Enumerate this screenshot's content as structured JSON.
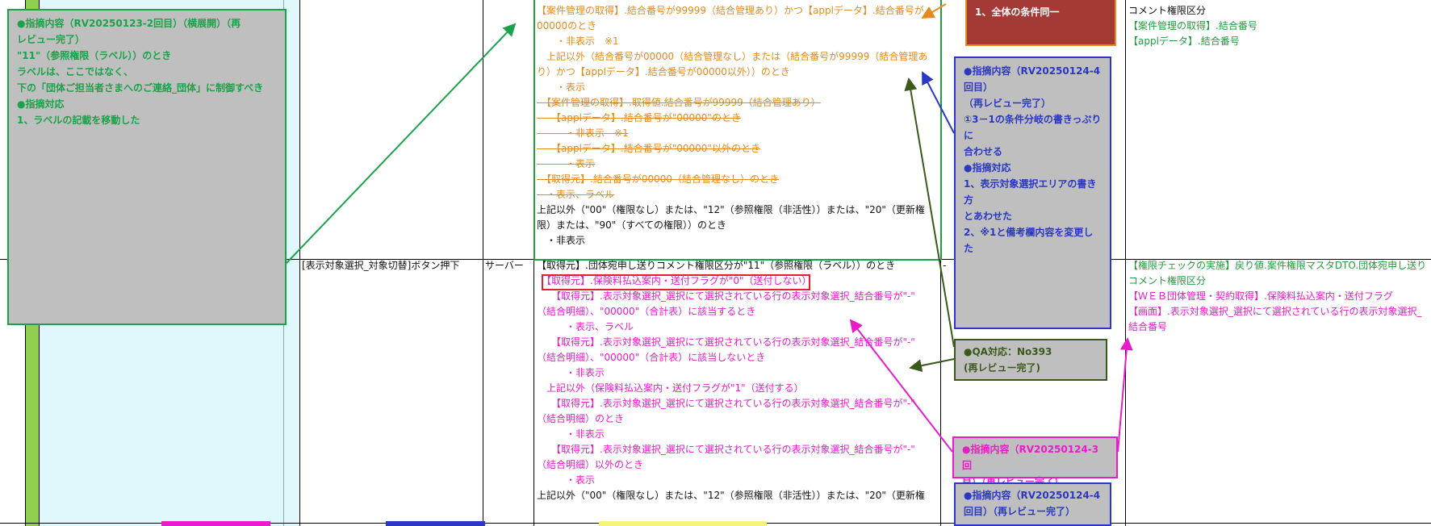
{
  "colors": {
    "green_note_bg": "#bfbfbf",
    "green_note_border": "#1aa34a",
    "blue_note_border": "#2a38c4",
    "pink_note_border": "#e81cc8",
    "olive_note_border": "#3b5a1a",
    "dark_red_bg": "#a33a36",
    "light_cyan_col": "#dff8fb",
    "green_strip": "#8fd14f"
  },
  "top_row": {
    "c_text": [
      {
        "text": "【案件管理の取得】.結合番号が99999（結合管理あり）かつ【applデータ】.結合番号が",
        "cls": "orange"
      },
      {
        "text": "00000のとき",
        "cls": "orange"
      },
      {
        "text": "　　・非表示　※1",
        "cls": "orange"
      },
      {
        "text": "　上記以外（結合番号が00000（結合管理なし）または（結合番号が99999（結合管理あ",
        "cls": "orange"
      },
      {
        "text": "り）かつ【applデータ】.結合番号が00000以外））のとき",
        "cls": "orange"
      },
      {
        "text": "　　・表示",
        "cls": "orange"
      },
      {
        "text": "　【案件管理の取得】.取得値.結合番号が99999（結合管理あり）",
        "cls": "orange strike"
      },
      {
        "text": "　　【applデータ】.結合番号が\"00000\"のとき",
        "cls": "orange strike"
      },
      {
        "text": "　　　・非表示　※1",
        "cls": "orange strike"
      },
      {
        "text": "　　【applデータ】.結合番号が\"00000\"以外のとき",
        "cls": "orange strike"
      },
      {
        "text": "　　　・表示",
        "cls": "orange strike"
      },
      {
        "text": "　【取得元】.結合番号が00000（結合管理なし）のとき",
        "cls": "orange strike"
      },
      {
        "text": "　・表示、ラベル",
        "cls": "orange strike"
      },
      {
        "text": "上記以外（\"00\"（権限なし）または、\"12\"（参照権限（非活性））または、\"20\"（更新権",
        "cls": "black"
      },
      {
        "text": "限）または、\"90\"（すべての権限））のとき",
        "cls": "black"
      },
      {
        "text": "　・非表示",
        "cls": "black"
      }
    ],
    "right_text": [
      {
        "text": "コメント権限区分",
        "cls": "black"
      },
      {
        "text": "【案件管理の取得】.結合番号",
        "cls": "green"
      },
      {
        "text": "【applデータ】.結合番号",
        "cls": "green"
      }
    ]
  },
  "bottom_row": {
    "a_text": "[表示対象選択_対象切替]ボタン押下",
    "b_text": "サーバー",
    "dash": "-",
    "c_text": [
      {
        "text": "【取得元】.団体宛申し送りコメント権限区分が\"11\"（参照権限（ラベル））のとき",
        "cls": "black"
      },
      {
        "text": "　【取得元】.保険料払込案内・送付フラグが\"0\"（送付しない）",
        "cls": "pink"
      },
      {
        "text": "　　【取得元】.表示対象選択_選択にて選択されている行の表示対象選択_結合番号が\"-\"",
        "cls": "pink"
      },
      {
        "text": "（結合明細）、\"00000\"（合計表）に該当するとき",
        "cls": "pink"
      },
      {
        "text": "　　　・表示、ラベル",
        "cls": "pink"
      },
      {
        "text": "　　【取得元】.表示対象選択_選択にて選択されている行の表示対象選択_結合番号が\"-\"",
        "cls": "pink"
      },
      {
        "text": "（結合明細）、\"00000\"（合計表）に該当しないとき",
        "cls": "pink"
      },
      {
        "text": "　　　・非表示",
        "cls": "pink"
      },
      {
        "text": "　上記以外（保険料払込案内・送付フラグが\"1\"（送付する）",
        "cls": "pink"
      },
      {
        "text": "　　【取得元】.表示対象選択_選択にて選択されている行の表示対象選択_結合番号が\"-\"",
        "cls": "pink"
      },
      {
        "text": "（結合明細）のとき",
        "cls": "pink"
      },
      {
        "text": "　　　・非表示",
        "cls": "pink"
      },
      {
        "text": "　　【取得元】.表示対象選択_選択にて選択されている行の表示対象選択_結合番号が\"-\"",
        "cls": "pink"
      },
      {
        "text": "（結合明細）以外のとき",
        "cls": "pink"
      },
      {
        "text": "　　　・表示",
        "cls": "pink"
      },
      {
        "text": "上記以外（\"00\"（権限なし）または、\"12\"（参照権限（非活性））または、\"20\"（更新権",
        "cls": "black"
      }
    ],
    "right_text": [
      {
        "text": "【権限チェックの実施】戻り値.案件権限マスタDTO.団体宛申し送り",
        "cls": "green"
      },
      {
        "text": "コメント権限区分",
        "cls": "green"
      },
      {
        "text": "【ＷＥＢ団体管理・契約取得】.保険料払込案内・送付フラグ",
        "cls": "pink"
      },
      {
        "text": "【画面】.表示対象選択_選択にて選択されている行の表示対象選択_",
        "cls": "pink"
      },
      {
        "text": "結合番号",
        "cls": "pink"
      }
    ]
  },
  "notes": {
    "green": [
      "●指摘内容（RV20250123-2回目）（横展開）（再",
      "レビュー完了）",
      "\"11\"（参照権限（ラベル））のとき",
      "ラベルは、ここではなく、",
      "下の「団体ご担当者さまへのご連絡_団体」に制御すべき",
      "●指摘対応",
      "1、ラベルの記載を移動した"
    ],
    "dark_red": "1、全体の条件同一",
    "blue_top": [
      "●指摘内容（RV20250124-4",
      "回目）",
      "（再レビュー完了）",
      "①3－1の条件分岐の書きっぷりに",
      "合わせる",
      "●指摘対応",
      "1、表示対象選択エリアの書き方",
      "とあわせた",
      "2、※1と備考欄内容を変更した"
    ],
    "olive": [
      "●QA対応：No393",
      "(再レビュー完了)"
    ],
    "pink": [
      "●指摘内容（RV20250124-3回",
      "目）（再レビュー完了）"
    ],
    "blue_bottom": [
      "●指摘内容（RV20250124-4",
      "回目）（再レビュー完了）"
    ]
  }
}
